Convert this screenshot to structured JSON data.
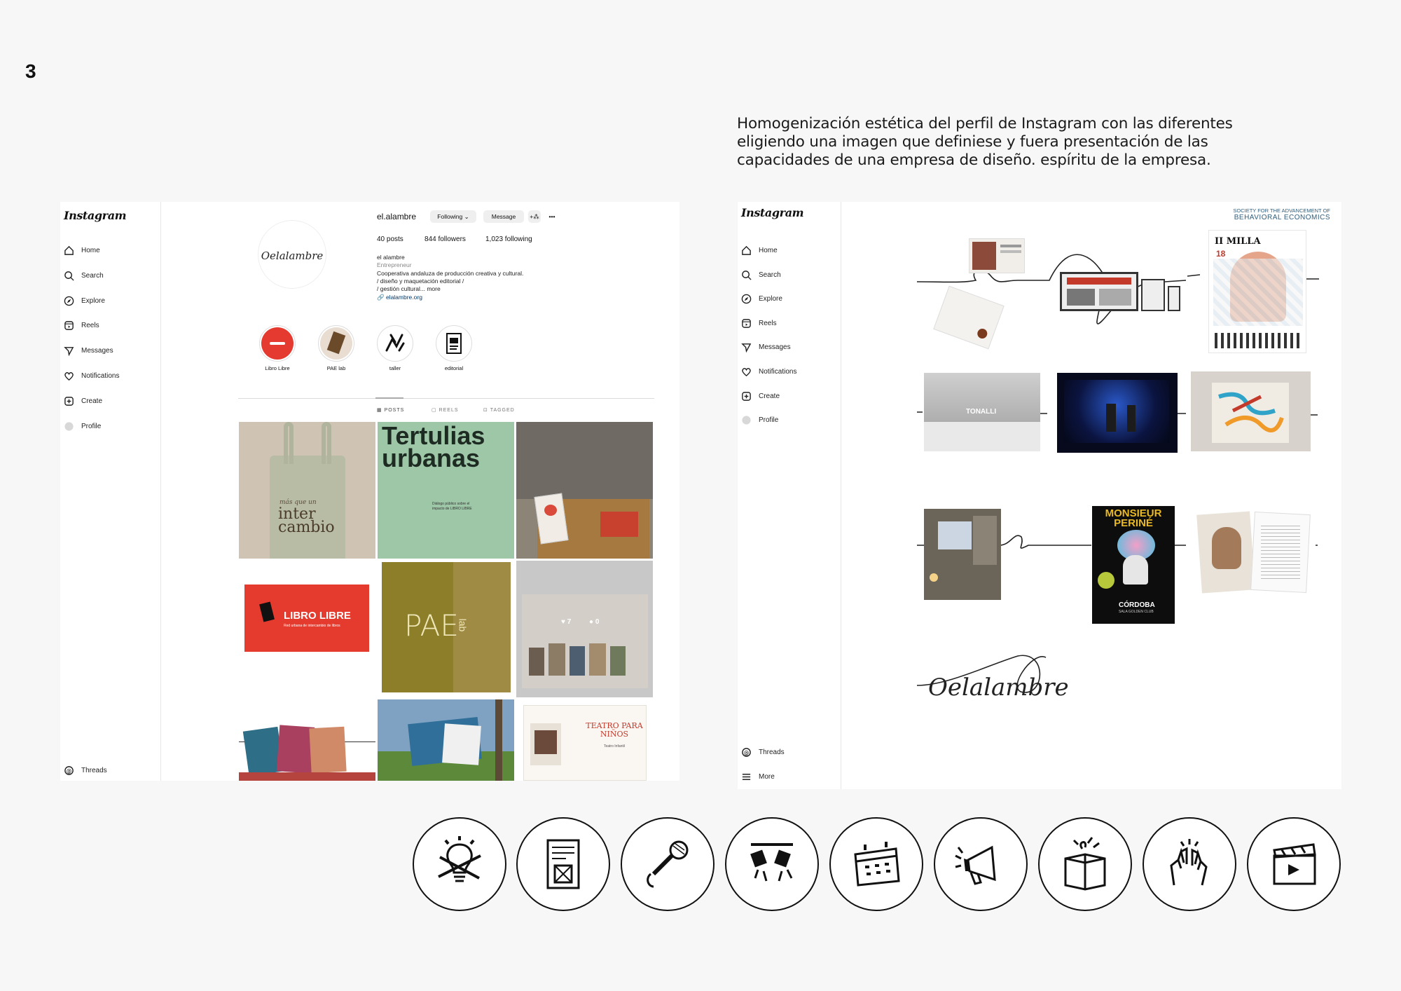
{
  "page_number": "3",
  "description": "Homogenización estética del perfil de Instagram con las diferentes eligiendo una imagen que definiese y fuera presentación de las capacidades de una empresa de diseño. espíritu de la empresa.",
  "left_screenshot": {
    "logo": "Instagram",
    "nav": [
      {
        "label": "Home",
        "icon": "home-icon"
      },
      {
        "label": "Search",
        "icon": "search-icon"
      },
      {
        "label": "Explore",
        "icon": "compass-icon"
      },
      {
        "label": "Reels",
        "icon": "reels-icon"
      },
      {
        "label": "Messages",
        "icon": "send-icon"
      },
      {
        "label": "Notifications",
        "icon": "heart-icon"
      },
      {
        "label": "Create",
        "icon": "plus-square-icon"
      },
      {
        "label": "Profile",
        "icon": "profile-avatar-icon"
      }
    ],
    "threads": "Threads",
    "profile": {
      "username": "el.alambre",
      "following_btn": "Following ⌄",
      "message_btn": "Message",
      "add_btn": "+⁂",
      "more": "•••",
      "posts": "40 posts",
      "followers": "844 followers",
      "following": "1,023 following",
      "name": "el alambre",
      "category": "Entrepreneur",
      "bio_1": "Cooperativa andaluza de producción creativa y cultural.",
      "bio_2": "/ diseño y maquetación editorial /",
      "bio_3": "/ gestión cultural... more",
      "link": "elalambre.org",
      "avatar_text": "Oelalambre"
    },
    "highlights": [
      {
        "label": "Libro Libre"
      },
      {
        "label": "PAE lab"
      },
      {
        "label": "taller"
      },
      {
        "label": "editorial"
      }
    ],
    "tabs": [
      "POSTS",
      "REELS",
      "TAGGED"
    ],
    "tiles": {
      "bag_top": "más que un",
      "bag_main": "inter\ncambio",
      "tertulias": "Tertulias urbanas",
      "tertulias_sub": "Diálogo público sobre el impacto de LIBRO LIBRE",
      "libro_libre": "LIBRO LIBRE",
      "libro_libre_sub": "Red urbana de intercambio de libros",
      "pae": "PAE",
      "pae_lab": "lab",
      "teatro": "TEATRO PARA NIÑOS",
      "teatro_sub": "Teatro Infantil",
      "likes": "♥ 7",
      "comments": "● 0"
    }
  },
  "right_screenshot": {
    "logo": "Instagram",
    "nav": [
      {
        "label": "Home",
        "icon": "home-icon"
      },
      {
        "label": "Search",
        "icon": "search-icon"
      },
      {
        "label": "Explore",
        "icon": "compass-icon"
      },
      {
        "label": "Reels",
        "icon": "reels-icon"
      },
      {
        "label": "Messages",
        "icon": "send-icon"
      },
      {
        "label": "Notifications",
        "icon": "heart-icon"
      },
      {
        "label": "Create",
        "icon": "plus-square-icon"
      },
      {
        "label": "Profile",
        "icon": "profile-avatar-icon"
      }
    ],
    "threads": "Threads",
    "more": "More",
    "society_line1": "SOCIETY FOR THE ADVANCEMENT OF",
    "society_line2": "BEHAVIORAL ECONOMICS",
    "milla": "II MILLA",
    "milla_date": "18",
    "tonalli": "TONALLI",
    "monsieur": "MONSIEUR PERINÉ",
    "cordoba": "CÓRDOBA",
    "cordoba_sub": "SALA GOLDEN CLUB",
    "signature": "Oelalambre"
  },
  "categories": [
    {
      "icon": "idea-lightbulb-icon"
    },
    {
      "icon": "editorial-document-icon"
    },
    {
      "icon": "microphone-icon"
    },
    {
      "icon": "stage-lights-icon"
    },
    {
      "icon": "calendar-icon"
    },
    {
      "icon": "megaphone-icon"
    },
    {
      "icon": "gift-box-icon"
    },
    {
      "icon": "raised-hands-icon"
    },
    {
      "icon": "clapperboard-icon"
    }
  ]
}
